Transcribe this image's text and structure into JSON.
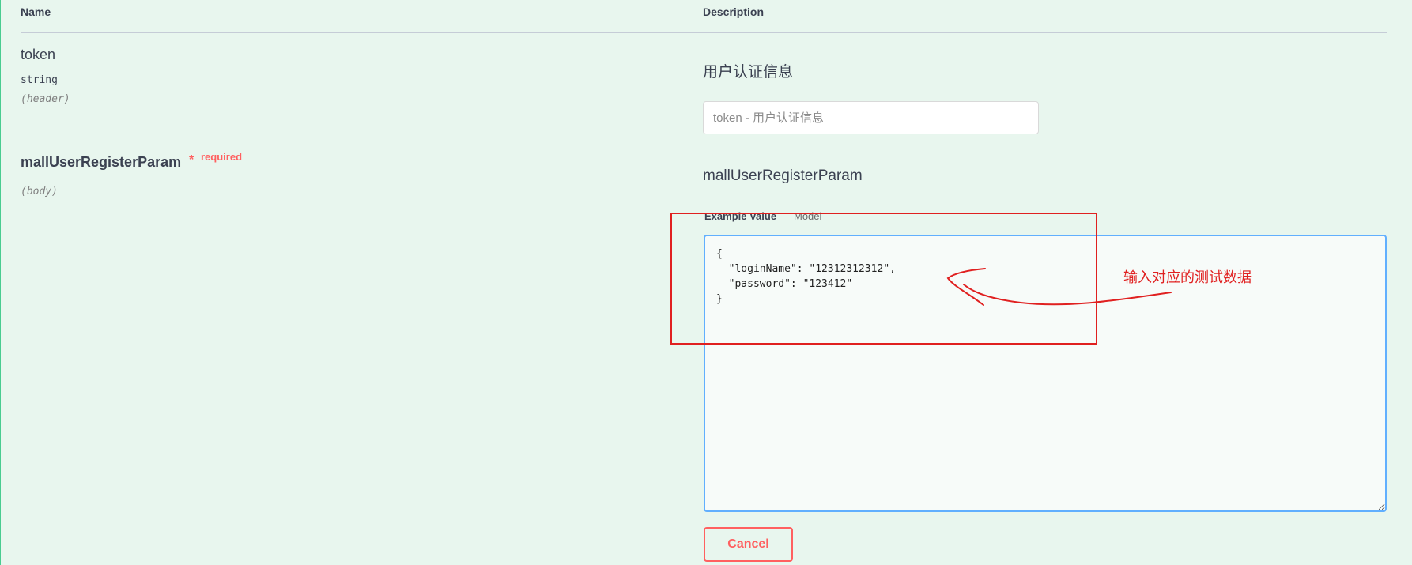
{
  "table": {
    "header_name": "Name",
    "header_description": "Description"
  },
  "params": {
    "token": {
      "name": "token",
      "type": "string",
      "in": "(header)",
      "description": "用户认证信息",
      "placeholder": "token - 用户认证信息"
    },
    "body": {
      "name": "mallUserRegisterParam",
      "required_star": "*",
      "required_label": "required",
      "in": "(body)",
      "description": "mallUserRegisterParam",
      "tabs": [
        "Example Value",
        "Model"
      ],
      "value": "{\n  \"loginName\": \"12312312312\",\n  \"password\": \"123412\"\n}"
    }
  },
  "actions": {
    "cancel_label": "Cancel"
  },
  "annotation": {
    "text": "输入对应的测试数据",
    "color": "#e02020"
  },
  "colors": {
    "panel_bg": "#e8f6ee",
    "panel_accent": "#49cc90",
    "editor_border": "#61affe",
    "danger": "#ff6060"
  }
}
